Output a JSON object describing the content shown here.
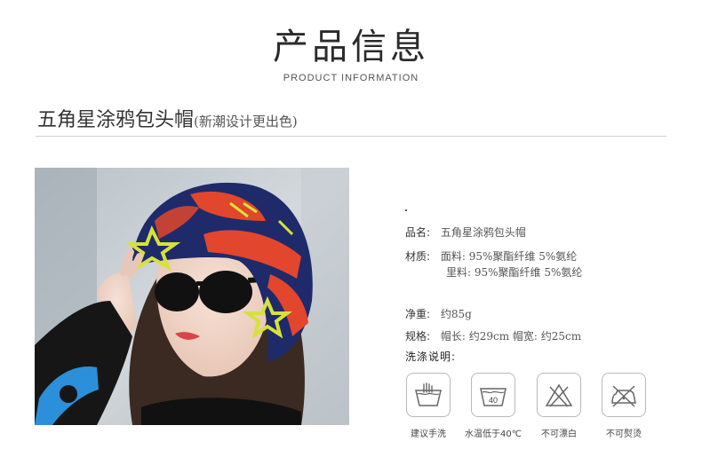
{
  "header": {
    "title": "产品信息",
    "subtitle": "PRODUCT  INFORMATION"
  },
  "product": {
    "title": "五角星涂鸦包头帽",
    "title_note": "(新潮设计更出色)"
  },
  "specs": {
    "name_key": "品名:",
    "name_value": "五角星涂鸦包头帽",
    "material_key": "材质:",
    "face_value": "面料: 95%聚酯纤维  5%氨纶",
    "lining_value": "里料: 95%聚酯纤维  5%氨纶",
    "weight_key": "净重:",
    "weight_value": "约85g",
    "size_key": "规格:",
    "size_value": "帽长: 约29cm  帽宽: 约25cm"
  },
  "wash": {
    "title": "洗涤说明:",
    "items": [
      {
        "label": "建议手洗",
        "icon": "hand-wash-icon"
      },
      {
        "label": "水温低于40℃",
        "icon": "wash-40-icon",
        "temp": "40"
      },
      {
        "label": "不可漂白",
        "icon": "no-bleach-icon"
      },
      {
        "label": "不可熨烫",
        "icon": "no-iron-icon"
      }
    ]
  },
  "colors": {
    "hat_navy": "#1f2a6b",
    "hat_red": "#e2462c",
    "hat_yellow": "#d6e23a",
    "background_gray": "#c9cfd4"
  }
}
